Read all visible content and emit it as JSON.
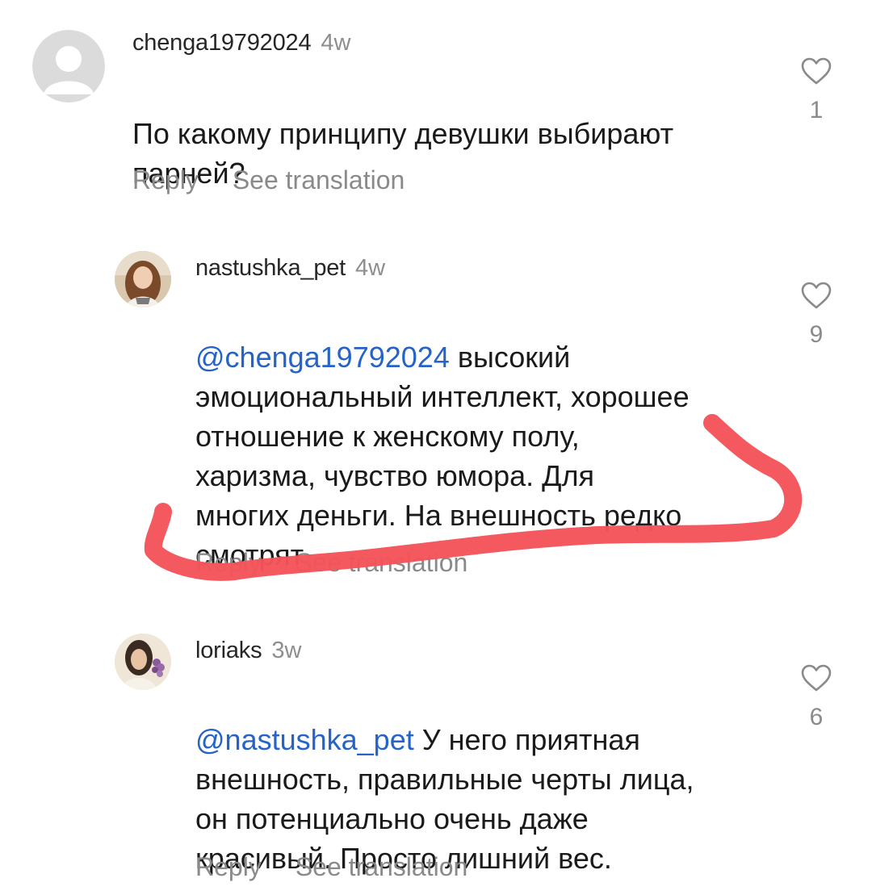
{
  "comments": [
    {
      "username": "chenga19792024",
      "time": "4w",
      "mention": "",
      "text": "По какому принципу девушки выбирают\nпарней?",
      "likes": "1",
      "reply_label": "Reply",
      "translate_label": "See translation",
      "avatar": "default-avatar-icon"
    },
    {
      "username": "nastushka_pet",
      "time": "4w",
      "mention": "@chenga19792024",
      "text": "высокий\nэмоциональный интеллект, хорошее\nотношение к женскому полу,\nхаризма, чувство юмора. Для\nмногих деньги. На внешность редко\nсмотрят",
      "likes": "9",
      "reply_label": "Reply",
      "translate_label": "See translation",
      "avatar": "user-photo-avatar"
    },
    {
      "username": "loriaks",
      "time": "3w",
      "mention": "@nastushka_pet",
      "text": "У него приятная\nвнешность, правильные черты лица,\nон потенциально очень даже\nкрасивый. Просто лишний вес.",
      "likes": "6",
      "reply_label": "Reply",
      "translate_label": "See translation",
      "avatar": "user-photo-avatar"
    }
  ],
  "colors": {
    "mention": "#2563c9",
    "muted": "#8a8a8a",
    "annotation": "#f4545a"
  },
  "icons": {
    "like": "heart-outline-icon"
  }
}
